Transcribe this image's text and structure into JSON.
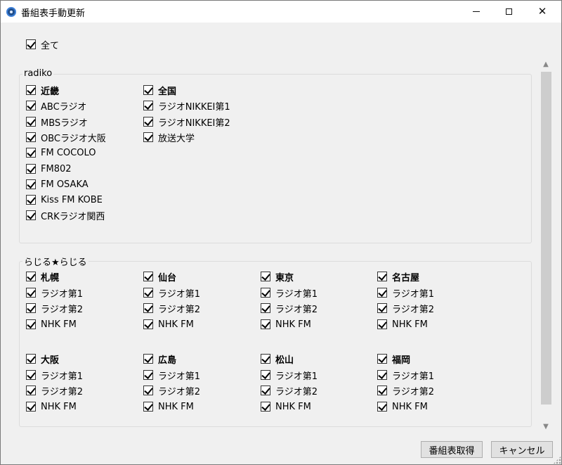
{
  "window": {
    "title": "番組表手動更新",
    "icon": "app-disc-icon",
    "controls": [
      "minimize",
      "maximize",
      "close"
    ]
  },
  "all_checkbox": {
    "label": "全て",
    "checked": true
  },
  "radiko": {
    "title": "radiko",
    "columns": [
      {
        "header": "近畿",
        "items": [
          "ABCラジオ",
          "MBSラジオ",
          "OBCラジオ大阪",
          "FM COCOLO",
          "FM802",
          "FM OSAKA",
          "Kiss FM KOBE",
          "CRKラジオ関西"
        ]
      },
      {
        "header": "全国",
        "items": [
          "ラジオNIKKEI第1",
          "ラジオNIKKEI第2",
          "放送大学"
        ]
      }
    ]
  },
  "radiru": {
    "title": "らじる★らじる",
    "rows": [
      [
        {
          "header": "札幌",
          "items": [
            "ラジオ第1",
            "ラジオ第2",
            "NHK FM"
          ]
        },
        {
          "header": "仙台",
          "items": [
            "ラジオ第1",
            "ラジオ第2",
            "NHK FM"
          ]
        },
        {
          "header": "東京",
          "items": [
            "ラジオ第1",
            "ラジオ第2",
            "NHK FM"
          ]
        },
        {
          "header": "名古屋",
          "items": [
            "ラジオ第1",
            "ラジオ第2",
            "NHK FM"
          ]
        }
      ],
      [
        {
          "header": "大阪",
          "items": [
            "ラジオ第1",
            "ラジオ第2",
            "NHK FM"
          ]
        },
        {
          "header": "広島",
          "items": [
            "ラジオ第1",
            "ラジオ第2",
            "NHK FM"
          ]
        },
        {
          "header": "松山",
          "items": [
            "ラジオ第1",
            "ラジオ第2",
            "NHK FM"
          ]
        },
        {
          "header": "福岡",
          "items": [
            "ラジオ第1",
            "ラジオ第2",
            "NHK FM"
          ]
        }
      ]
    ]
  },
  "buttons": {
    "fetch_label": "番組表取得",
    "cancel_label": "キャンセル"
  }
}
